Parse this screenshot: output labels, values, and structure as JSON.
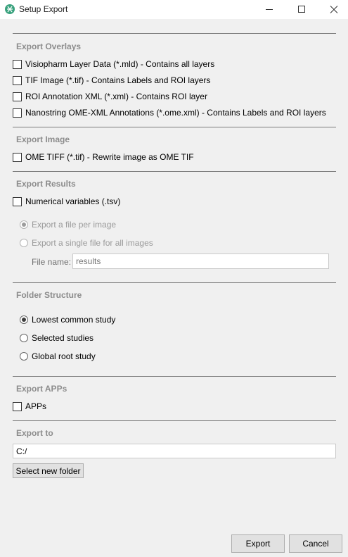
{
  "window": {
    "title": "Setup Export",
    "app_icon": "visiopharm-logo-icon",
    "controls": [
      "minimize-icon",
      "maximize-icon",
      "close-icon"
    ]
  },
  "export_overlays": {
    "title": "Export Overlays",
    "options": [
      {
        "label": "Visiopharm Layer Data (*.mld) - Contains all layers",
        "checked": false
      },
      {
        "label": "TIF Image (*.tif) - Contains Labels and ROI layers",
        "checked": false
      },
      {
        "label": "ROI Annotation XML (*.xml) - Contains ROI layer",
        "checked": false
      },
      {
        "label": "Nanostring OME-XML Annotations (*.ome.xml) - Contains Labels and ROI layers",
        "checked": false
      }
    ]
  },
  "export_image": {
    "title": "Export Image",
    "options": [
      {
        "label": "OME TIFF (*.tif) - Rewrite image as OME TIF",
        "checked": false
      }
    ]
  },
  "export_results": {
    "title": "Export Results",
    "numerical_label": "Numerical variables (.tsv)",
    "numerical_checked": false,
    "radios": [
      {
        "label": "Export a file per image",
        "selected": true,
        "enabled": false
      },
      {
        "label": "Export a single file for all images",
        "selected": false,
        "enabled": false
      }
    ],
    "file_name_label": "File name:",
    "file_name_value": "",
    "file_name_placeholder": "results"
  },
  "folder_structure": {
    "title": "Folder Structure",
    "radios": [
      {
        "label": "Lowest common study",
        "selected": true
      },
      {
        "label": "Selected studies",
        "selected": false
      },
      {
        "label": "Global root study",
        "selected": false
      }
    ]
  },
  "export_apps": {
    "title": "Export APPs",
    "option": {
      "label": "APPs",
      "checked": false
    }
  },
  "export_to": {
    "title": "Export to",
    "path_value": "C:/",
    "select_folder_label": "Select new folder"
  },
  "footer": {
    "export_label": "Export",
    "cancel_label": "Cancel"
  },
  "colors": {
    "window_bg": "#f0f0f0",
    "titlebar_bg": "#ffffff",
    "section_title": "#8c8c8c",
    "app_icon": "#3aa27e"
  }
}
